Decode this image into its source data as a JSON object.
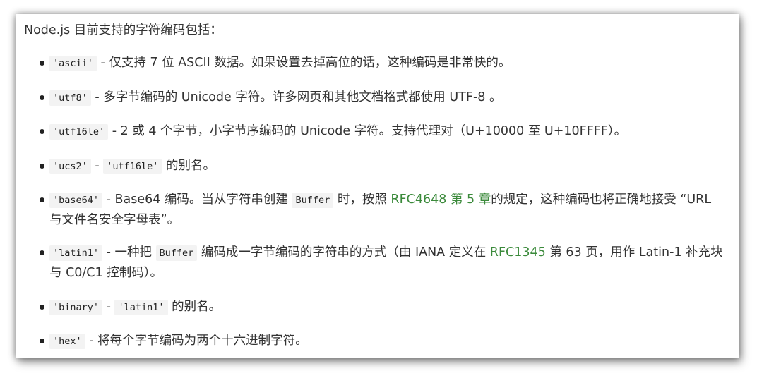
{
  "intro": "Node.js 目前支持的字符编码包括：",
  "items": [
    {
      "code": "'ascii'",
      "text": " - 仅支持 7 位 ASCII 数据。如果设置去掉高位的话，这种编码是非常快的。"
    },
    {
      "code": "'utf8'",
      "text": " - 多字节编码的 Unicode 字符。许多网页和其他文档格式都使用 UTF-8 。"
    },
    {
      "code": "'utf16le'",
      "text": " - 2 或 4 个字节，小字节序编码的 Unicode 字符。支持代理对（U+10000 至 U+10FFFF）。"
    },
    {
      "code": "'ucs2'",
      "sep": " - ",
      "code2": "'utf16le'",
      "text": " 的别名。"
    },
    {
      "code": "'base64'",
      "text": " - Base64 编码。当从字符串创建 ",
      "code2": "Buffer",
      "text2": " 时，按照 ",
      "link": "RFC4648 第 5 章",
      "text3": "的规定，这种编码也将正确地接受 “URL 与文件名安全字母表”。"
    },
    {
      "code": "'latin1'",
      "text": " - 一种把 ",
      "code2": "Buffer",
      "text2": " 编码成一字节编码的字符串的方式（由 IANA 定义在 ",
      "link": "RFC1345",
      "text3": " 第 63 页，用作 Latin-1 补充块与 C0/C1 控制码）。"
    },
    {
      "code": "'binary'",
      "sep": " - ",
      "code2": "'latin1'",
      "text": " 的别名。"
    },
    {
      "code": "'hex'",
      "text": " - 将每个字节编码为两个十六进制字符。"
    }
  ]
}
